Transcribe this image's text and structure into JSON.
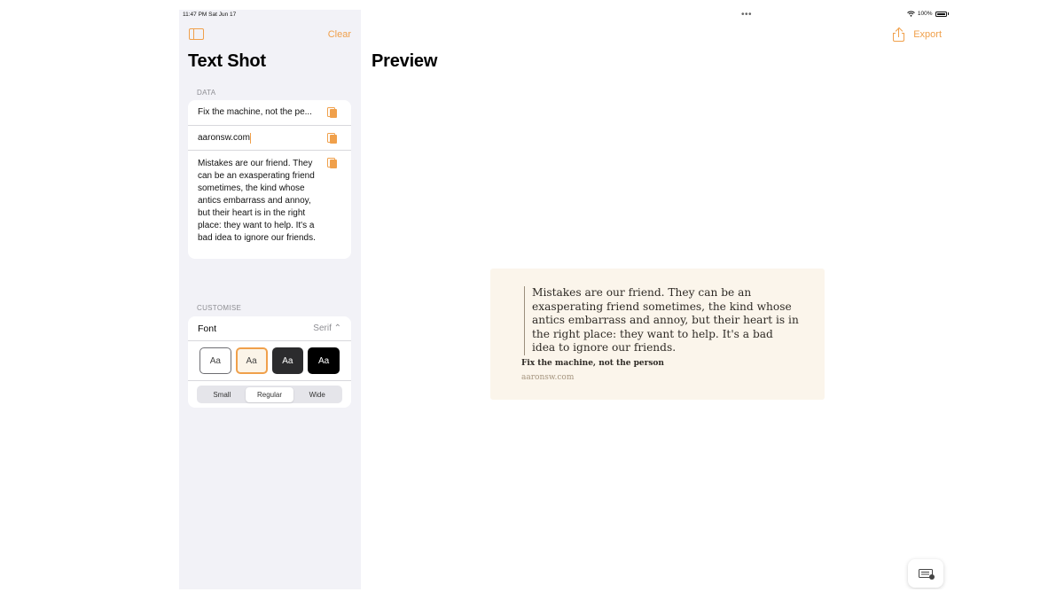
{
  "status_bar": {
    "time": "11:47 PM  Sat Jun 17",
    "multitask_dots": "•••",
    "battery_percent": "100%"
  },
  "sidebar": {
    "clear_label": "Clear",
    "title": "Text Shot",
    "data_section_label": "DATA",
    "fields": {
      "title_value": "Fix the machine, not the pe...",
      "source_value": "aaronsw.com",
      "quote_value": "Mistakes are our friend. They can be an exasperating friend sometimes, the kind whose antics embarrass and annoy, but their heart is in the right place: they want to help. It's a bad idea to ignore our friends."
    },
    "customise_section_label": "CUSTOMISE",
    "font_label": "Font",
    "font_value": "Serif ⌃",
    "themes": [
      {
        "label": "Aa",
        "name": "light"
      },
      {
        "label": "Aa",
        "name": "sepia",
        "selected": true
      },
      {
        "label": "Aa",
        "name": "dark"
      },
      {
        "label": "Aa",
        "name": "black"
      }
    ],
    "widths": [
      {
        "label": "Small"
      },
      {
        "label": "Regular",
        "selected": true
      },
      {
        "label": "Wide"
      }
    ]
  },
  "detail": {
    "title": "Preview",
    "export_label": "Export",
    "quote": {
      "body": "Mistakes are our friend. They can be an exasperating friend sometimes, the kind whose antics embarrass and annoy, but their heart is in the right place: they want to help. It's a bad idea to ignore our friends.",
      "title": "Fix the machine, not the person",
      "source": "aaronsw.com"
    }
  },
  "colors": {
    "accent": "#f0a04b",
    "sidebar_bg": "#f2f2f7",
    "quote_card_bg": "#fbf5eb"
  },
  "icons": {
    "sidebar_toggle": "sidebar-toggle-icon",
    "paste": "paste-icon",
    "export": "share-icon",
    "keyboard": "keyboard-hide-icon"
  }
}
